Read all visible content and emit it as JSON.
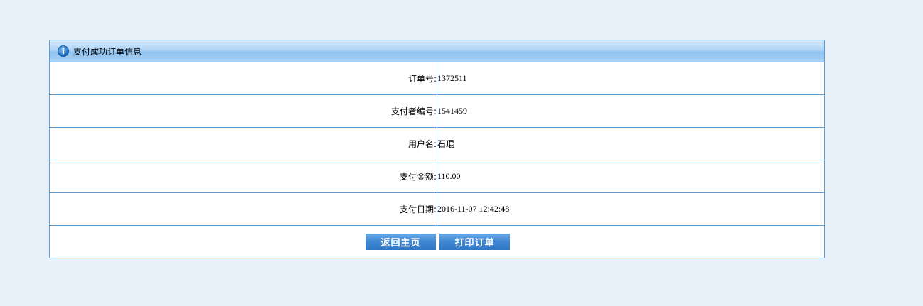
{
  "panel": {
    "title": "支付成功订单信息",
    "icon": "info-icon"
  },
  "rows": [
    {
      "label": "订单号:",
      "value": "1372511"
    },
    {
      "label": "支付者编号:",
      "value": "1541459"
    },
    {
      "label": "用户名:",
      "value": "石琨"
    },
    {
      "label": "支付金额:",
      "value": "110.00"
    },
    {
      "label": "支付日期:",
      "value": "2016-11-07 12:42:48"
    }
  ],
  "actions": {
    "back_home": "返回主页",
    "print_order": "打印订单"
  },
  "colors": {
    "page_background": "#e8f1fa",
    "border": "#5a9ad6",
    "button": "#3f87d3"
  }
}
